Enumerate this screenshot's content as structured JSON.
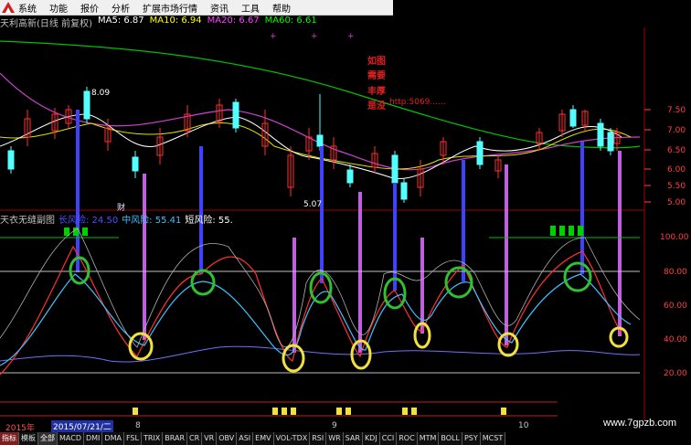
{
  "menu": {
    "items": [
      "系统",
      "功能",
      "报价",
      "分析",
      "扩展市场行情",
      "资讯",
      "工具",
      "帮助"
    ]
  },
  "title": {
    "stock": "天利高新(日线 前复权)",
    "ma5": "MA5: 6.87",
    "ma10": "MA10: 6.94",
    "ma20": "MA20: 6.67",
    "ma60": "MA60: 6.61"
  },
  "colors": {
    "ma5": "#ffffff",
    "ma10": "#ffff00",
    "ma20": "#ff40ff",
    "ma60": "#00ff00",
    "up": "#ff3030",
    "down": "#54ffff",
    "bg": "#000000"
  },
  "annotation_lines": [
    "如图",
    "需要",
    "丰厚",
    "是没",
    "http:5069......"
  ],
  "price_axis": {
    "labels": [
      "7.50",
      "7.00",
      "6.50",
      "6.00",
      "5.50",
      "5.00"
    ]
  },
  "price_marks": {
    "high": "8.09",
    "low": "5.07"
  },
  "sub": {
    "name": "天衣无缝副图",
    "long_risk": "长风险: 24.50",
    "mid_risk": "中风险: 55.41",
    "short_risk": "短风险: 55.",
    "axis": [
      "100.00",
      "80.00",
      "60.00",
      "40.00",
      "20.00"
    ],
    "cai_label": "财"
  },
  "dates": {
    "year": "2015年",
    "selected": "2015/07/21/二",
    "m8": "8",
    "m9": "9",
    "m10": "10"
  },
  "tabs": [
    "指标",
    "模板",
    "全部",
    "MACD",
    "DMI",
    "DMA",
    "FSL",
    "TRIX",
    "BRAR",
    "CR",
    "VR",
    "OBV",
    "ASI",
    "EMV",
    "VOL-TDX",
    "RSI",
    "WR",
    "SAR",
    "KDJ",
    "CCI",
    "ROC",
    "MTM",
    "BOLL",
    "PSY",
    "MCST"
  ],
  "watermark": "www.7gpzb.com"
}
